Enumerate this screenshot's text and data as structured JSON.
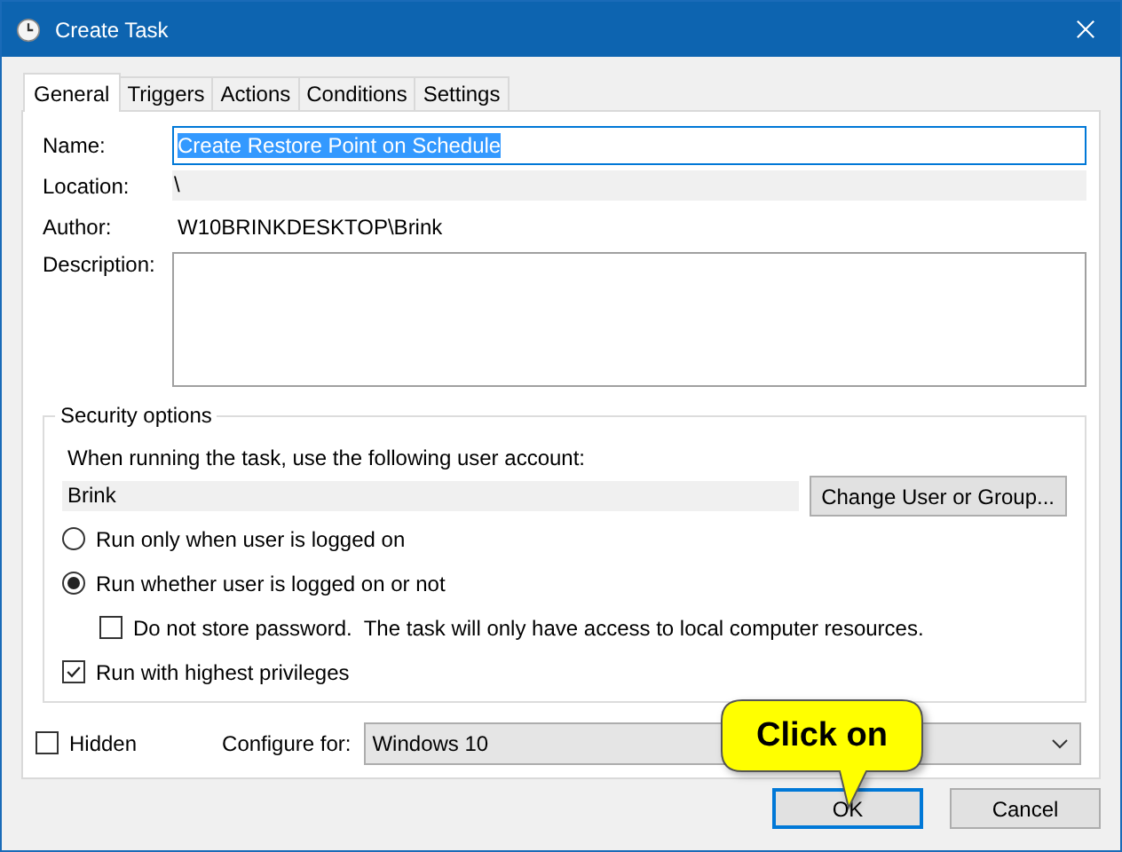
{
  "window": {
    "title": "Create Task"
  },
  "tabs": [
    {
      "label": "General",
      "selected": true
    },
    {
      "label": "Triggers",
      "selected": false
    },
    {
      "label": "Actions",
      "selected": false
    },
    {
      "label": "Conditions",
      "selected": false
    },
    {
      "label": "Settings",
      "selected": false
    }
  ],
  "general": {
    "name": {
      "label": "Name:",
      "value": "Create Restore Point on Schedule",
      "text_selected": true
    },
    "location": {
      "label": "Location:",
      "value": "\\"
    },
    "author": {
      "label": "Author:",
      "value": "W10BRINKDESKTOP\\Brink"
    },
    "description": {
      "label": "Description:"
    }
  },
  "security": {
    "title": "Security options",
    "account_prompt": "When running the task, use the following user account:",
    "account": "Brink",
    "change_button": "Change User or Group...",
    "options": [
      {
        "kind": "radio",
        "label": "Run only when user is logged on",
        "selected": false
      },
      {
        "kind": "radio",
        "label": "Run whether user is logged on or not",
        "selected": true,
        "children": [
          {
            "kind": "checkbox",
            "label": "Do not store password.  The task will only have access to local computer resources.",
            "checked": false
          }
        ]
      },
      {
        "kind": "checkbox",
        "label": "Run with highest privileges",
        "checked": true
      }
    ]
  },
  "hidden": {
    "label": "Hidden",
    "checked": false
  },
  "configure": {
    "label": "Configure for:",
    "value": "Windows 10"
  },
  "buttons": [
    {
      "label": "OK",
      "default": true
    },
    {
      "label": "Cancel",
      "default": false
    }
  ],
  "callout": {
    "text": "Click on"
  }
}
